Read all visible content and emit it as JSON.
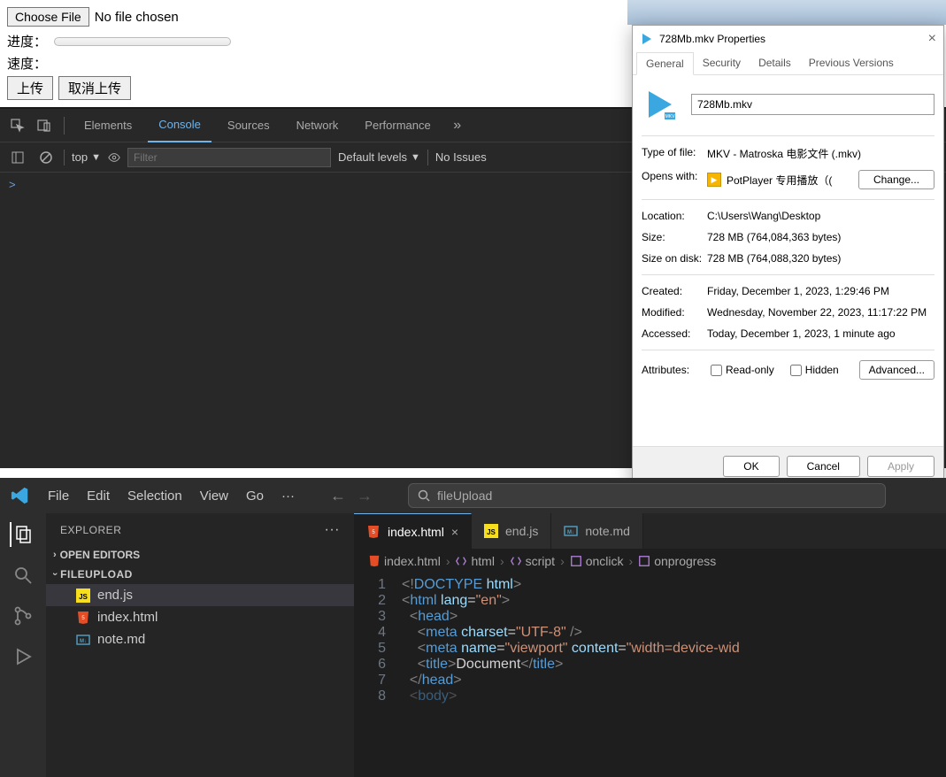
{
  "page": {
    "choose_file": "Choose File",
    "no_file": "No file chosen",
    "progress_label": "进度：",
    "speed_label": "速度：",
    "upload": "上传",
    "cancel_upload": "取消上传"
  },
  "devtools": {
    "tabs": [
      "Elements",
      "Console",
      "Sources",
      "Network",
      "Performance"
    ],
    "active_tab": "Console",
    "top": "top",
    "filter_placeholder": "Filter",
    "levels": "Default levels",
    "issues": "No Issues",
    "prompt": ">"
  },
  "props": {
    "title": "728Mb.mkv Properties",
    "tabs": [
      "General",
      "Security",
      "Details",
      "Previous Versions"
    ],
    "active_tab": "General",
    "filename": "728Mb.mkv",
    "rows": {
      "type_label": "Type of file:",
      "type_val": "MKV - Matroska 电影文件 (.mkv)",
      "opens_label": "Opens with:",
      "opens_val": "PotPlayer 专用播放（(",
      "change": "Change...",
      "location_label": "Location:",
      "location_val": "C:\\Users\\Wang\\Desktop",
      "size_label": "Size:",
      "size_val": "728 MB (764,084,363 bytes)",
      "disk_label": "Size on disk:",
      "disk_val": "728 MB (764,088,320 bytes)",
      "created_label": "Created:",
      "created_val": "Friday, December 1, 2023, 1:29:46 PM",
      "modified_label": "Modified:",
      "modified_val": "Wednesday, November 22, 2023, 11:17:22 PM",
      "accessed_label": "Accessed:",
      "accessed_val": "Today, December 1, 2023, 1 minute ago",
      "attr_label": "Attributes:",
      "readonly": "Read-only",
      "hidden": "Hidden",
      "advanced": "Advanced..."
    },
    "footer": {
      "ok": "OK",
      "cancel": "Cancel",
      "apply": "Apply"
    }
  },
  "vscode": {
    "menu": [
      "File",
      "Edit",
      "Selection",
      "View",
      "Go"
    ],
    "search": "fileUpload",
    "explorer": {
      "title": "EXPLORER",
      "open_editors": "OPEN EDITORS",
      "folder": "FILEUPLOAD",
      "files": [
        {
          "name": "end.js",
          "type": "js"
        },
        {
          "name": "index.html",
          "type": "html"
        },
        {
          "name": "note.md",
          "type": "md"
        }
      ]
    },
    "tabs": [
      {
        "name": "index.html",
        "type": "html",
        "active": true
      },
      {
        "name": "end.js",
        "type": "js",
        "active": false
      },
      {
        "name": "note.md",
        "type": "md",
        "active": false
      }
    ],
    "breadcrumb": [
      "index.html",
      "html",
      "script",
      "onclick",
      "onprogress"
    ],
    "code": [
      {
        "n": 1,
        "html": "<span class='tok-bracket'>&lt;!</span><span class='tok-tag'>DOCTYPE</span> <span class='tok-attr'>html</span><span class='tok-bracket'>&gt;</span>"
      },
      {
        "n": 2,
        "html": "<span class='tok-bracket'>&lt;</span><span class='tok-tag'>html</span> <span class='tok-attr'>lang</span>=<span class='tok-str'>\"en\"</span><span class='tok-bracket'>&gt;</span>"
      },
      {
        "n": 3,
        "html": "  <span class='tok-bracket'>&lt;</span><span class='tok-tag'>head</span><span class='tok-bracket'>&gt;</span>"
      },
      {
        "n": 4,
        "html": "    <span class='tok-bracket'>&lt;</span><span class='tok-tag'>meta</span> <span class='tok-attr'>charset</span>=<span class='tok-str'>\"UTF-8\"</span> <span class='tok-bracket'>/&gt;</span>"
      },
      {
        "n": 5,
        "html": "    <span class='tok-bracket'>&lt;</span><span class='tok-tag'>meta</span> <span class='tok-attr'>name</span>=<span class='tok-str'>\"viewport\"</span> <span class='tok-attr'>content</span>=<span class='tok-str'>\"width=device-wid</span>"
      },
      {
        "n": 6,
        "html": "    <span class='tok-bracket'>&lt;</span><span class='tok-tag'>title</span><span class='tok-bracket'>&gt;</span><span class='tok-text'>Document</span><span class='tok-bracket'>&lt;/</span><span class='tok-tag'>title</span><span class='tok-bracket'>&gt;</span>"
      },
      {
        "n": 7,
        "html": "  <span class='tok-bracket'>&lt;/</span><span class='tok-tag'>head</span><span class='tok-bracket'>&gt;</span>"
      },
      {
        "n": 8,
        "html": "  <span class='tok-bracket' style='opacity:.5'>&lt;</span><span class='tok-tag' style='opacity:.5'>body</span><span class='tok-bracket' style='opacity:.5'>&gt;</span>"
      }
    ]
  }
}
